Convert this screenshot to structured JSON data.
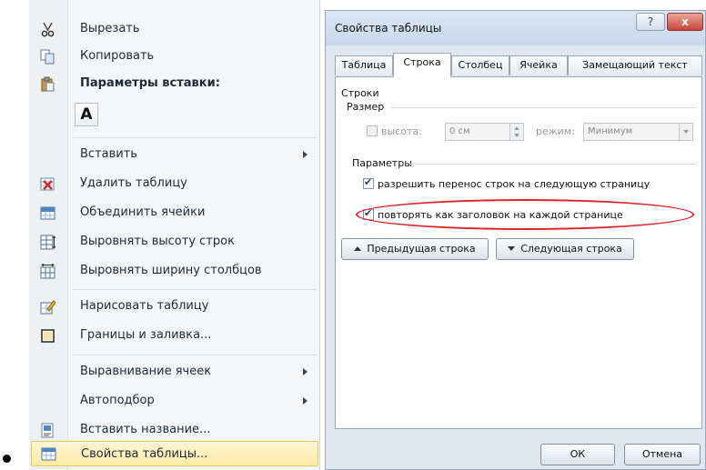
{
  "context_menu": {
    "cut": "Вырезать",
    "copy": "Копировать",
    "paste_options": "Параметры вставки:",
    "paste_keep_text": "A",
    "insert": "Вставить",
    "delete_table": "Удалить таблицу",
    "merge_cells": "Объединить ячейки",
    "distribute_rows": "Выровнять высоту строк",
    "distribute_columns": "Выровнять ширину столбцов",
    "draw_table": "Нарисовать таблицу",
    "borders_shading": "Границы и заливка...",
    "cell_alignment": "Выравнивание ячеек",
    "autofit": "Автоподбор",
    "insert_caption": "Вставить название...",
    "table_properties": "Свойства таблицы..."
  },
  "dialog": {
    "title": "Свойства таблицы",
    "help": "?",
    "close": "x",
    "tabs": [
      "Таблица",
      "Строка",
      "Столбец",
      "Ячейка",
      "Замещающий текст"
    ],
    "active_tab": "Строка",
    "section_rows": "Строки",
    "group_size": "Размер",
    "height_label": "высота:",
    "height_value": "0 см",
    "mode_label": "режим:",
    "mode_value": "Минимум",
    "group_params": "Параметры",
    "allow_break": "разрешить перенос строк на следующую страницу",
    "allow_break_checked": true,
    "repeat_header": "повторять как заголовок на каждой странице",
    "repeat_header_checked": true,
    "prev_row": "Предыдущая строка",
    "next_row": "Следующая строка",
    "ok": "ОК",
    "cancel": "Отмена"
  },
  "colors": {
    "highlight_ellipse": "#e0202a",
    "menu_hover": "#fde9a3"
  }
}
